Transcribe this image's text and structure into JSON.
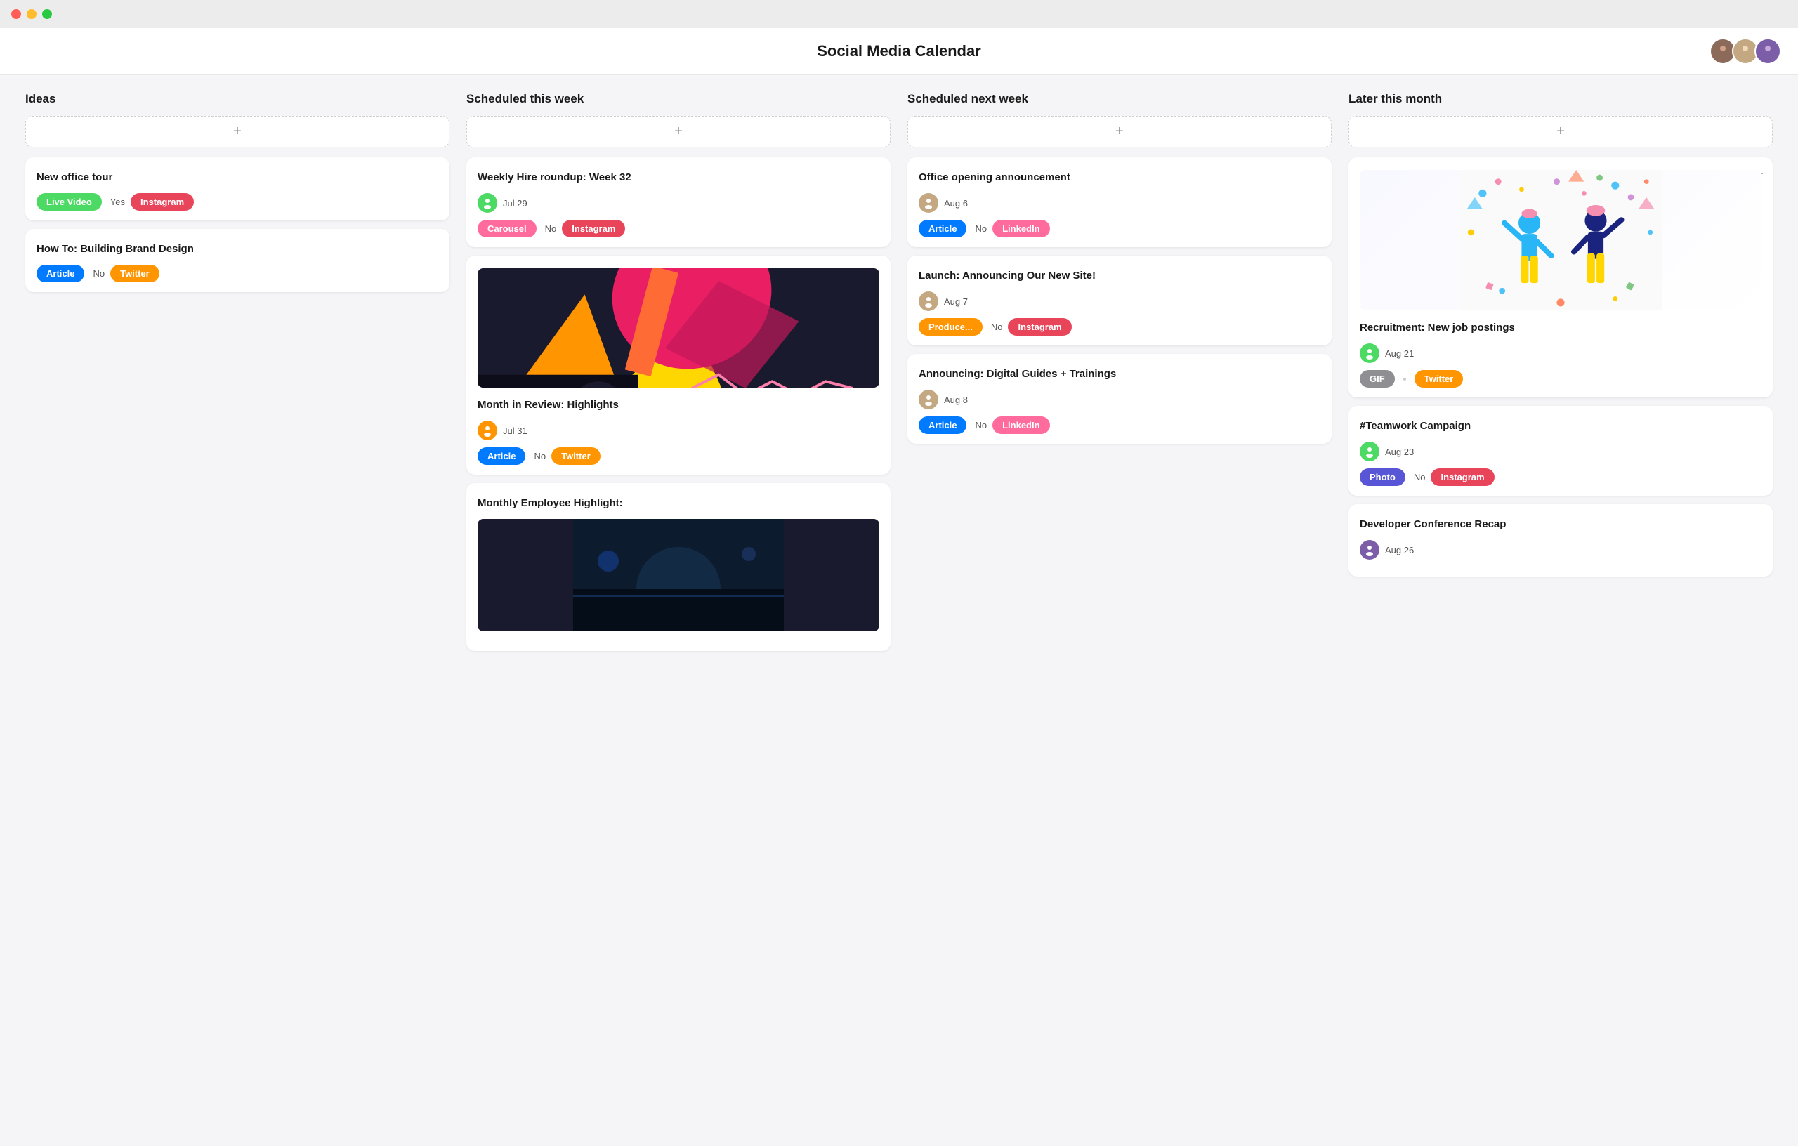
{
  "app": {
    "title": "Social Media Calendar"
  },
  "titlebar": {
    "dots": [
      "red",
      "yellow",
      "green"
    ]
  },
  "columns": [
    {
      "id": "ideas",
      "header": "Ideas",
      "cards": [
        {
          "id": "new-office-tour",
          "title": "New office tour",
          "tags": [
            {
              "label": "Live Video",
              "type": "live"
            },
            {
              "label": "Instagram",
              "type": "instagram"
            }
          ],
          "approval": "Yes"
        },
        {
          "id": "building-brand",
          "title": "How To: Building Brand Design",
          "tags": [
            {
              "label": "Article",
              "type": "article"
            },
            {
              "label": "Twitter",
              "type": "twitter"
            }
          ],
          "approval": "No"
        }
      ]
    },
    {
      "id": "scheduled-this-week",
      "header": "Scheduled this week",
      "cards": [
        {
          "id": "weekly-hire",
          "title": "Weekly Hire roundup: Week 32",
          "date": "Jul 29",
          "avatar_color": "#4cd964",
          "tags": [
            {
              "label": "Carousel",
              "type": "carousel"
            },
            {
              "label": "Instagram",
              "type": "instagram"
            }
          ],
          "approval": "No",
          "has_image": false
        },
        {
          "id": "month-in-review",
          "title": "Month in Review: Highlights",
          "date": "Jul 31",
          "avatar_color": "#ff9500",
          "tags": [
            {
              "label": "Article",
              "type": "article"
            },
            {
              "label": "Twitter",
              "type": "twitter"
            }
          ],
          "approval": "No",
          "has_image": true
        },
        {
          "id": "monthly-employee",
          "title": "Monthly Employee Highlight:",
          "has_image_bottom": true
        }
      ]
    },
    {
      "id": "scheduled-next-week",
      "header": "Scheduled next week",
      "cards": [
        {
          "id": "office-opening",
          "title": "Office opening announcement",
          "date": "Aug 6",
          "avatar_color": "#c4a882",
          "tags": [
            {
              "label": "Article",
              "type": "article"
            },
            {
              "label": "LinkedIn",
              "type": "linkedin"
            }
          ],
          "approval": "No"
        },
        {
          "id": "launch-new-site",
          "title": "Launch: Announcing Our New Site!",
          "date": "Aug 7",
          "avatar_color": "#c4a882",
          "tags": [
            {
              "label": "Produce...",
              "type": "product"
            },
            {
              "label": "Instagram",
              "type": "instagram"
            }
          ],
          "approval": "No"
        },
        {
          "id": "digital-guides",
          "title": "Announcing: Digital Guides + Trainings",
          "date": "Aug 8",
          "avatar_color": "#c4a882",
          "tags": [
            {
              "label": "Article",
              "type": "article"
            },
            {
              "label": "LinkedIn",
              "type": "linkedin"
            }
          ],
          "approval": "No"
        }
      ]
    },
    {
      "id": "later-this-month",
      "header": "Later this month",
      "cards": [
        {
          "id": "recruitment",
          "title": "Recruitment: New job postings",
          "date": "Aug 21",
          "avatar_color": "#4cd964",
          "tags": [
            {
              "label": "GIF",
              "type": "gif"
            },
            {
              "label": "Twitter",
              "type": "twitter"
            }
          ],
          "has_celebration_image": true
        },
        {
          "id": "teamwork-campaign",
          "title": "#Teamwork Campaign",
          "date": "Aug 23",
          "avatar_color": "#4cd964",
          "tags": [
            {
              "label": "Photo",
              "type": "photo"
            },
            {
              "label": "Instagram",
              "type": "instagram"
            }
          ],
          "approval": "No"
        },
        {
          "id": "developer-conference",
          "title": "Developer Conference Recap",
          "date": "Aug 26"
        }
      ]
    }
  ],
  "labels": {
    "add": "+",
    "yes": "Yes",
    "no": "No"
  }
}
